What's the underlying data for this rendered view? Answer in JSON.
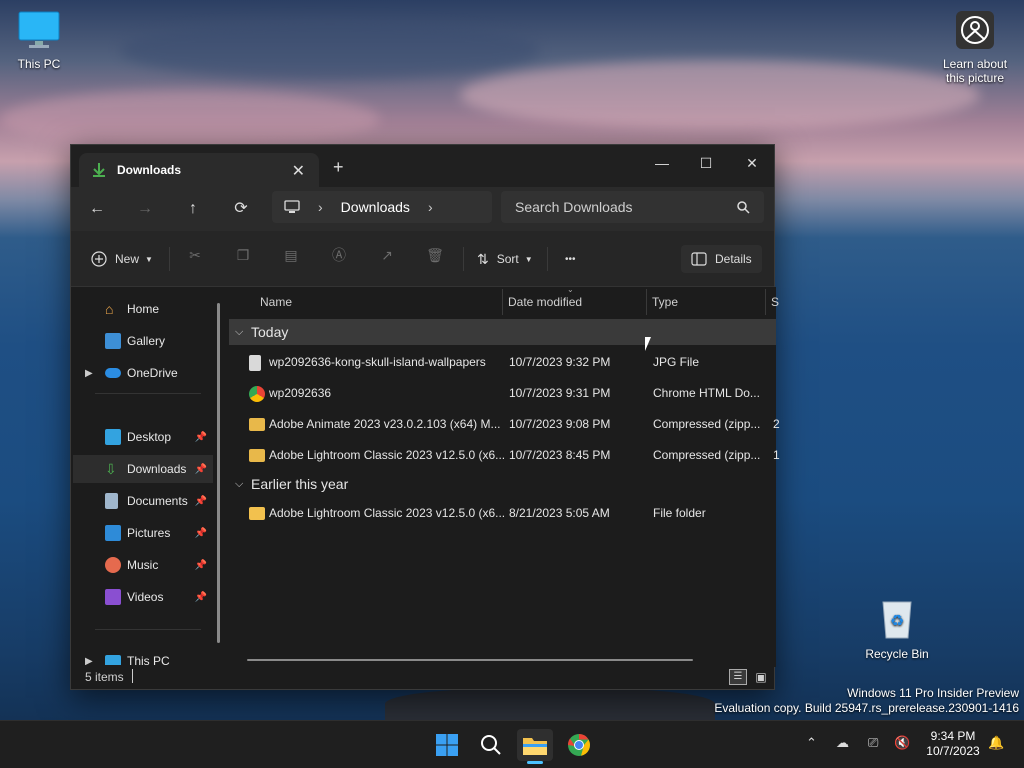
{
  "desktop": {
    "this_pc_label": "This PC",
    "learn_label_1": "Learn about",
    "learn_label_2": "this picture",
    "recycle_label": "Recycle Bin",
    "watermark_line1": "Windows 11 Pro Insider Preview",
    "watermark_line2": "Evaluation copy. Build 25947.rs_prerelease.230901-1416"
  },
  "window": {
    "tab_title": "Downloads",
    "close_tab": "✕",
    "new_tab": "+",
    "minimize": "—",
    "maximize": "☐",
    "close": "✕"
  },
  "nav": {
    "back": "←",
    "forward": "→",
    "up": "↑",
    "refresh": "⟳",
    "breadcrumb": "Downloads",
    "search_placeholder": "Search Downloads"
  },
  "toolbar": {
    "new_label": "New",
    "sort_label": "Sort",
    "more_label": "•••",
    "details_label": "Details"
  },
  "sidebar": {
    "items": [
      {
        "label": "Home"
      },
      {
        "label": "Gallery"
      },
      {
        "label": "OneDrive"
      },
      {
        "label": "Desktop"
      },
      {
        "label": "Downloads"
      },
      {
        "label": "Documents"
      },
      {
        "label": "Pictures"
      },
      {
        "label": "Music"
      },
      {
        "label": "Videos"
      },
      {
        "label": "This PC"
      }
    ]
  },
  "columns": {
    "name": "Name",
    "date": "Date modified",
    "type": "Type",
    "size": "S"
  },
  "groups": {
    "today": "Today",
    "earlier": "Earlier this year"
  },
  "files": [
    {
      "name": "wp2092636-kong-skull-island-wallpapers",
      "date": "10/7/2023 9:32 PM",
      "type": "JPG File",
      "extra": ""
    },
    {
      "name": "wp2092636",
      "date": "10/7/2023 9:31 PM",
      "type": "Chrome HTML Do...",
      "extra": ""
    },
    {
      "name": "Adobe Animate 2023 v23.0.2.103 (x64) M...",
      "date": "10/7/2023 9:08 PM",
      "type": "Compressed (zipp...",
      "extra": "2"
    },
    {
      "name": "Adobe Lightroom Classic 2023 v12.5.0 (x6...",
      "date": "10/7/2023 8:45 PM",
      "type": "Compressed (zipp...",
      "extra": "1"
    },
    {
      "name": "Adobe Lightroom Classic 2023 v12.5.0 (x6...",
      "date": "8/21/2023 5:05 AM",
      "type": "File folder",
      "extra": ""
    }
  ],
  "status": {
    "count": "5 items"
  },
  "clock": {
    "time": "9:34 PM",
    "date": "10/7/2023"
  }
}
